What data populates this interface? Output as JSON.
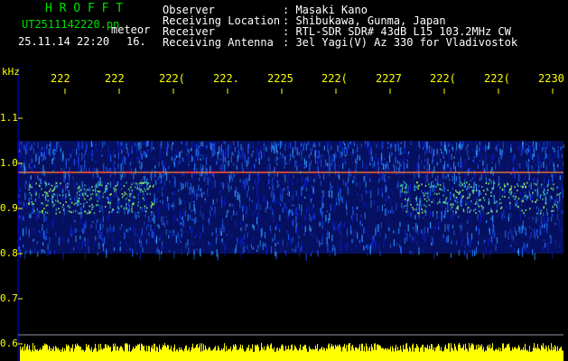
{
  "header": {
    "app_title": "H R O F F T",
    "file_name": "UT2511142220.pn",
    "mode": "meteor",
    "datetime": "25.11.14 22:20",
    "extra": "16.",
    "info": [
      {
        "label": "Observer",
        "value": ": Masaki Kano"
      },
      {
        "label": "Receiving Location",
        "value": ": Shibukawa, Gunma, Japan"
      },
      {
        "label": "Receiver",
        "value": ": RTL-SDR SDR# 43dB L15 103.2MHz CW"
      },
      {
        "label": "Receiving Antenna",
        "value": ": 3el Yagi(V) Az 330 for Vladivostok"
      }
    ]
  },
  "chart_data": {
    "type": "heatmap",
    "ylabel": "kHz",
    "y_ticks": [
      "1.1",
      "1.0",
      "0.9",
      "0.8",
      "0.7",
      "0.6"
    ],
    "y_values": [
      1.1,
      1.0,
      0.9,
      0.8,
      0.7,
      0.6
    ],
    "ylim": [
      0.6,
      1.15
    ],
    "x_ticks": [
      "222",
      "222",
      "222(",
      "222.",
      "2225",
      "222(",
      "2227",
      "222(",
      "222(",
      "2230"
    ],
    "signal_band": [
      0.8,
      1.05
    ],
    "carrier_line": 0.98,
    "colors": {
      "background": "#000000",
      "axis": "#0000ff",
      "tick_text": "#ffff00",
      "header_green": "#00e000",
      "header_white": "#ffffff",
      "noise_low": "#0a1cc8",
      "noise_high": "#2a9cff",
      "carrier": "#ff3030",
      "bottom_bars": "#ffff00"
    }
  }
}
